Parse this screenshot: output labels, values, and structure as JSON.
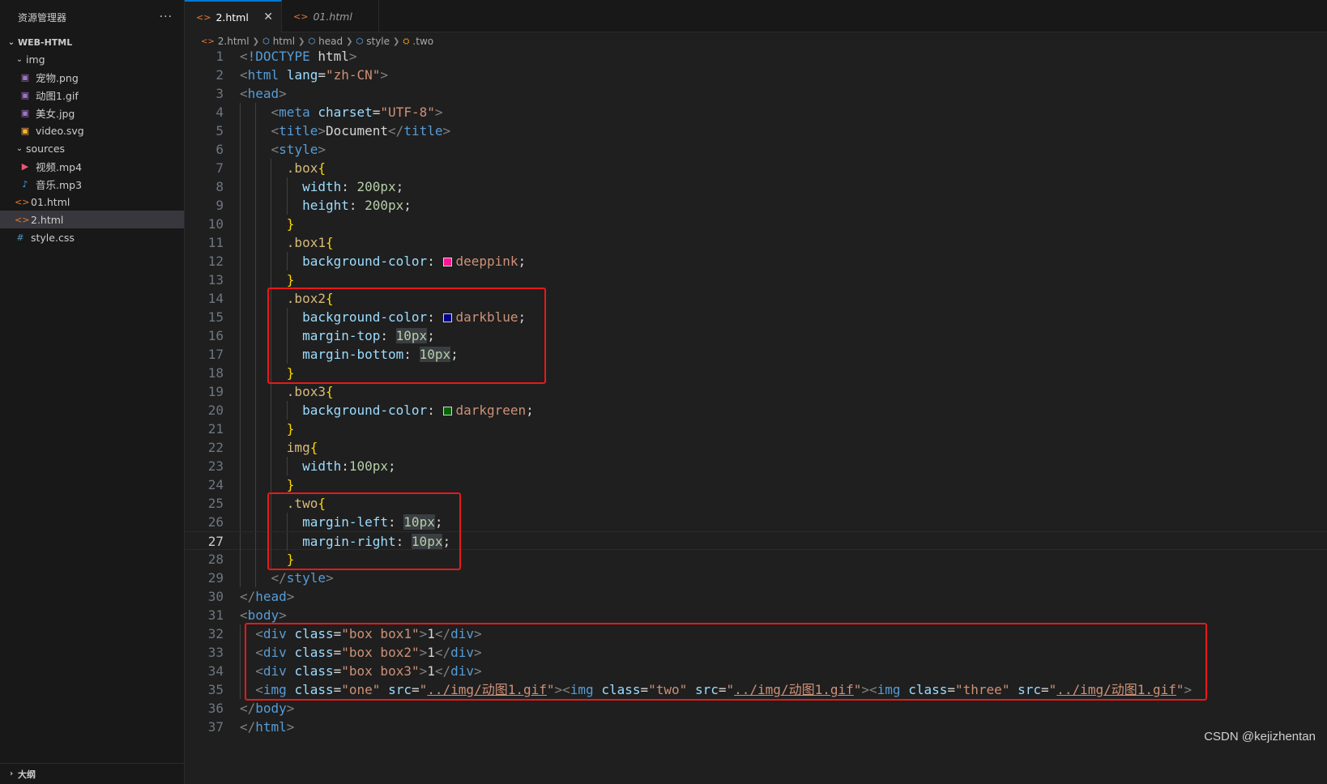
{
  "sidebar": {
    "title": "资源管理器",
    "more_label": "···",
    "project": "WEB-HTML",
    "items": [
      {
        "label": "img",
        "type": "folder",
        "depth": 1
      },
      {
        "label": "宠物.png",
        "type": "image",
        "depth": 2
      },
      {
        "label": "动图1.gif",
        "type": "image",
        "depth": 2
      },
      {
        "label": "美女.jpg",
        "type": "image",
        "depth": 2
      },
      {
        "label": "video.svg",
        "type": "svg",
        "depth": 2
      },
      {
        "label": "sources",
        "type": "folder",
        "depth": 1
      },
      {
        "label": "视频.mp4",
        "type": "video",
        "depth": 2
      },
      {
        "label": "音乐.mp3",
        "type": "audio",
        "depth": 2
      },
      {
        "label": "01.html",
        "type": "html",
        "depth": 1
      },
      {
        "label": "2.html",
        "type": "html",
        "depth": 1,
        "selected": true
      },
      {
        "label": "style.css",
        "type": "css",
        "depth": 1
      }
    ],
    "outline_label": "大纲"
  },
  "tabs": [
    {
      "label": "2.html",
      "active": true
    },
    {
      "label": "01.html",
      "active": false
    }
  ],
  "breadcrumb": [
    "2.html",
    "html",
    "head",
    "style",
    ".two"
  ],
  "editor": {
    "current_line": 27,
    "lines": [
      [
        [
          "p",
          "<"
        ],
        [
          "t",
          "!DOCTYPE"
        ],
        [
          "x",
          " "
        ],
        [
          "k",
          "html"
        ],
        [
          "p",
          ">"
        ]
      ],
      [
        [
          "p",
          "<"
        ],
        [
          "t",
          "html"
        ],
        [
          "x",
          " "
        ],
        [
          "a",
          "lang"
        ],
        [
          "x",
          "="
        ],
        [
          "s",
          "\"zh-CN\""
        ],
        [
          "p",
          ">"
        ]
      ],
      [
        [
          "p",
          "<"
        ],
        [
          "t",
          "head"
        ],
        [
          "p",
          ">"
        ]
      ],
      [
        [
          "x",
          "    "
        ],
        [
          "p",
          "<"
        ],
        [
          "t",
          "meta"
        ],
        [
          "x",
          " "
        ],
        [
          "a",
          "charset"
        ],
        [
          "x",
          "="
        ],
        [
          "s",
          "\"UTF-8\""
        ],
        [
          "p",
          ">"
        ]
      ],
      [
        [
          "x",
          "    "
        ],
        [
          "p",
          "<"
        ],
        [
          "t",
          "title"
        ],
        [
          "p",
          ">"
        ],
        [
          "x",
          "Document"
        ],
        [
          "p",
          "</"
        ],
        [
          "t",
          "title"
        ],
        [
          "p",
          ">"
        ]
      ],
      [
        [
          "x",
          "    "
        ],
        [
          "p",
          "<"
        ],
        [
          "t",
          "style"
        ],
        [
          "p",
          ">"
        ]
      ],
      [
        [
          "x",
          "      "
        ],
        [
          "sel",
          ".box"
        ],
        [
          "b",
          "{"
        ]
      ],
      [
        [
          "x",
          "        "
        ],
        [
          "pr",
          "width"
        ],
        [
          "x",
          ": "
        ],
        [
          "n",
          "200px"
        ],
        [
          "x",
          ";"
        ]
      ],
      [
        [
          "x",
          "        "
        ],
        [
          "pr",
          "height"
        ],
        [
          "x",
          ": "
        ],
        [
          "n",
          "200px"
        ],
        [
          "x",
          ";"
        ]
      ],
      [
        [
          "x",
          "      "
        ],
        [
          "b",
          "}"
        ]
      ],
      [
        [
          "x",
          "      "
        ],
        [
          "sel",
          ".box1"
        ],
        [
          "b",
          "{"
        ]
      ],
      [
        [
          "x",
          "        "
        ],
        [
          "pr",
          "background-color"
        ],
        [
          "x",
          ": "
        ],
        [
          "sw",
          "#ff1493"
        ],
        [
          "s",
          "deeppink"
        ],
        [
          "x",
          ";"
        ]
      ],
      [
        [
          "x",
          "      "
        ],
        [
          "b",
          "}"
        ]
      ],
      [
        [
          "x",
          "      "
        ],
        [
          "sel",
          ".box2"
        ],
        [
          "b",
          "{"
        ]
      ],
      [
        [
          "x",
          "        "
        ],
        [
          "pr",
          "background-color"
        ],
        [
          "x",
          ": "
        ],
        [
          "sw",
          "#00008b"
        ],
        [
          "s",
          "darkblue"
        ],
        [
          "x",
          ";"
        ]
      ],
      [
        [
          "x",
          "        "
        ],
        [
          "pr",
          "margin-top"
        ],
        [
          "x",
          ": "
        ],
        [
          "h",
          "10px"
        ],
        [
          "x",
          ";"
        ]
      ],
      [
        [
          "x",
          "        "
        ],
        [
          "pr",
          "margin-bottom"
        ],
        [
          "x",
          ": "
        ],
        [
          "h",
          "10px"
        ],
        [
          "x",
          ";"
        ]
      ],
      [
        [
          "x",
          "      "
        ],
        [
          "b",
          "}"
        ]
      ],
      [
        [
          "x",
          "      "
        ],
        [
          "sel",
          ".box3"
        ],
        [
          "b",
          "{"
        ]
      ],
      [
        [
          "x",
          "        "
        ],
        [
          "pr",
          "background-color"
        ],
        [
          "x",
          ": "
        ],
        [
          "sw",
          "#006400"
        ],
        [
          "s",
          "darkgreen"
        ],
        [
          "x",
          ";"
        ]
      ],
      [
        [
          "x",
          "      "
        ],
        [
          "b",
          "}"
        ]
      ],
      [
        [
          "x",
          "      "
        ],
        [
          "sel",
          "img"
        ],
        [
          "b",
          "{"
        ]
      ],
      [
        [
          "x",
          "        "
        ],
        [
          "pr",
          "width"
        ],
        [
          "x",
          ":"
        ],
        [
          "n",
          "100px"
        ],
        [
          "x",
          ";"
        ]
      ],
      [
        [
          "x",
          "      "
        ],
        [
          "b",
          "}"
        ]
      ],
      [
        [
          "x",
          "      "
        ],
        [
          "sel",
          ".two"
        ],
        [
          "b",
          "{"
        ]
      ],
      [
        [
          "x",
          "        "
        ],
        [
          "pr",
          "margin-left"
        ],
        [
          "x",
          ": "
        ],
        [
          "h",
          "10px"
        ],
        [
          "x",
          ";"
        ]
      ],
      [
        [
          "x",
          "        "
        ],
        [
          "pr",
          "margin-right"
        ],
        [
          "x",
          ": "
        ],
        [
          "h",
          "10px"
        ],
        [
          "x",
          ";"
        ]
      ],
      [
        [
          "x",
          "      "
        ],
        [
          "b",
          "}"
        ]
      ],
      [
        [
          "x",
          "    "
        ],
        [
          "p",
          "</"
        ],
        [
          "t",
          "style"
        ],
        [
          "p",
          ">"
        ]
      ],
      [
        [
          "p",
          "</"
        ],
        [
          "t",
          "head"
        ],
        [
          "p",
          ">"
        ]
      ],
      [
        [
          "p",
          "<"
        ],
        [
          "t",
          "body"
        ],
        [
          "p",
          ">"
        ]
      ],
      [
        [
          "x",
          "  "
        ],
        [
          "p",
          "<"
        ],
        [
          "t",
          "div"
        ],
        [
          "x",
          " "
        ],
        [
          "a",
          "class"
        ],
        [
          "x",
          "="
        ],
        [
          "s",
          "\"box box1\""
        ],
        [
          "p",
          ">"
        ],
        [
          "x",
          "1"
        ],
        [
          "p",
          "</"
        ],
        [
          "t",
          "div"
        ],
        [
          "p",
          ">"
        ]
      ],
      [
        [
          "x",
          "  "
        ],
        [
          "p",
          "<"
        ],
        [
          "t",
          "div"
        ],
        [
          "x",
          " "
        ],
        [
          "a",
          "class"
        ],
        [
          "x",
          "="
        ],
        [
          "s",
          "\"box box2\""
        ],
        [
          "p",
          ">"
        ],
        [
          "x",
          "1"
        ],
        [
          "p",
          "</"
        ],
        [
          "t",
          "div"
        ],
        [
          "p",
          ">"
        ]
      ],
      [
        [
          "x",
          "  "
        ],
        [
          "p",
          "<"
        ],
        [
          "t",
          "div"
        ],
        [
          "x",
          " "
        ],
        [
          "a",
          "class"
        ],
        [
          "x",
          "="
        ],
        [
          "s",
          "\"box box3\""
        ],
        [
          "p",
          ">"
        ],
        [
          "x",
          "1"
        ],
        [
          "p",
          "</"
        ],
        [
          "t",
          "div"
        ],
        [
          "p",
          ">"
        ]
      ],
      [
        [
          "x",
          "  "
        ],
        [
          "p",
          "<"
        ],
        [
          "t",
          "img"
        ],
        [
          "x",
          " "
        ],
        [
          "a",
          "class"
        ],
        [
          "x",
          "="
        ],
        [
          "s",
          "\"one\""
        ],
        [
          "x",
          " "
        ],
        [
          "a",
          "src"
        ],
        [
          "x",
          "="
        ],
        [
          "s",
          "\""
        ],
        [
          "u",
          "../img/动图1.gif"
        ],
        [
          "s",
          "\""
        ],
        [
          "p",
          "><"
        ],
        [
          "t",
          "img"
        ],
        [
          "x",
          " "
        ],
        [
          "a",
          "class"
        ],
        [
          "x",
          "="
        ],
        [
          "s",
          "\"two\""
        ],
        [
          "x",
          " "
        ],
        [
          "a",
          "src"
        ],
        [
          "x",
          "="
        ],
        [
          "s",
          "\""
        ],
        [
          "u",
          "../img/动图1.gif"
        ],
        [
          "s",
          "\""
        ],
        [
          "p",
          "><"
        ],
        [
          "t",
          "img"
        ],
        [
          "x",
          " "
        ],
        [
          "a",
          "class"
        ],
        [
          "x",
          "="
        ],
        [
          "s",
          "\"three\""
        ],
        [
          "x",
          " "
        ],
        [
          "a",
          "src"
        ],
        [
          "x",
          "="
        ],
        [
          "s",
          "\""
        ],
        [
          "u",
          "../img/动图1.gif"
        ],
        [
          "s",
          "\""
        ],
        [
          "p",
          ">"
        ]
      ],
      [
        [
          "p",
          "</"
        ],
        [
          "t",
          "body"
        ],
        [
          "p",
          ">"
        ]
      ],
      [
        [
          "p",
          "</"
        ],
        [
          "t",
          "html"
        ],
        [
          "p",
          ">"
        ]
      ]
    ]
  },
  "watermark": "CSDN @kejizhentan"
}
